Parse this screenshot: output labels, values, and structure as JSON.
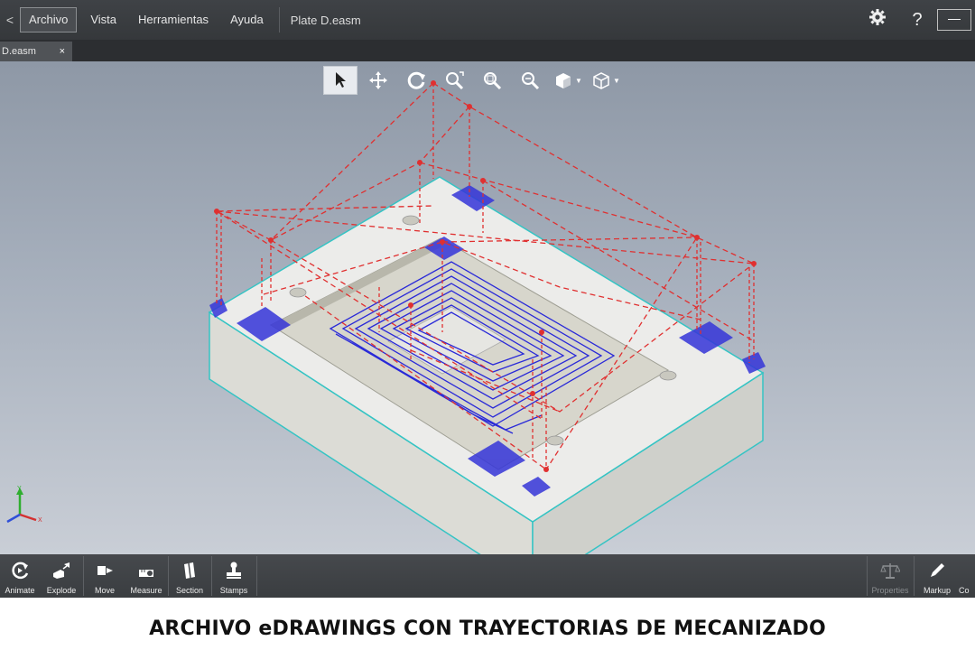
{
  "menubar": {
    "back_glyph": "<",
    "menus": [
      "Archivo",
      "Vista",
      "Herramientas",
      "Ayuda"
    ],
    "document_title": "Plate D.easm",
    "settings_glyph": "✿",
    "help_glyph": "?",
    "minimize_glyph": "—"
  },
  "tabs": [
    {
      "label": "D.easm",
      "close": "×"
    }
  ],
  "view_toolbar": {
    "tools": [
      "select-icon",
      "pan-icon",
      "rotate-icon",
      "zoom-to-fit-icon",
      "zoom-to-area-icon",
      "zoom-in-out-icon",
      "display-style-icon",
      "view-orientation-icon"
    ]
  },
  "bottom_toolbar": {
    "left_tools": [
      {
        "label": "Animate",
        "icon": "animate-icon"
      },
      {
        "label": "Explode",
        "icon": "explode-icon"
      },
      {
        "label": "Move",
        "icon": "move-icon"
      },
      {
        "label": "Measure",
        "icon": "measure-icon"
      },
      {
        "label": "Section",
        "icon": "section-icon"
      },
      {
        "label": "Stamps",
        "icon": "stamps-icon"
      }
    ],
    "right_tools": [
      {
        "label": "Properties",
        "icon": "properties-icon",
        "enabled": false
      },
      {
        "label": "Markup",
        "icon": "markup-icon",
        "enabled": true
      },
      {
        "label": "Co",
        "icon": "comments-icon",
        "enabled": true
      }
    ]
  },
  "triad": {
    "y": "Y",
    "x": "X"
  },
  "caption": "ARCHIVO eDRAWINGS CON TRAYECTORIAS DE MECANIZADO",
  "colors": {
    "toolpath_rapid": "#e03030",
    "toolpath_cut": "#2a2ad8",
    "part_top": "#ececec",
    "part_edge": "#35c4c4"
  }
}
